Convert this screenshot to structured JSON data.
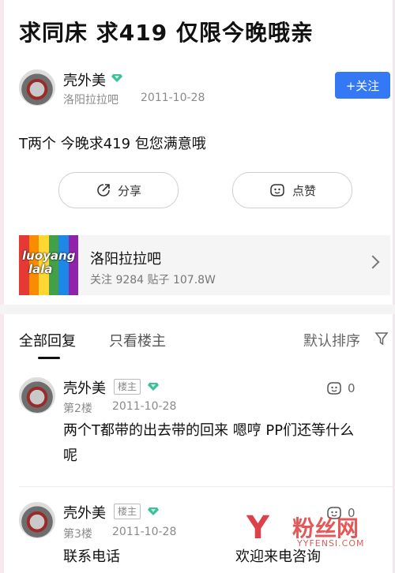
{
  "post": {
    "title": "求同床 求419 仅限今晚哦亲",
    "author": "壳外美",
    "forum_name": "洛阳拉拉吧",
    "date": "2011-10-28",
    "follow_label": "+关注",
    "content": "T两个 今晚求419 包您满意哦",
    "share_label": "分享",
    "like_label": "点赞"
  },
  "forum": {
    "logo_text_line1": "luoyang",
    "logo_text_line2": "lala",
    "logo_stripes": [
      "#e53935",
      "#fb8c00",
      "#fdd835",
      "#43a047",
      "#1e88e5",
      "#8e24aa"
    ],
    "name": "洛阳拉拉吧",
    "stats": "关注 9284  贴子 107.8W"
  },
  "tabs": {
    "all_replies": "全部回复",
    "owner_only": "只看楼主",
    "sort": "默认排序"
  },
  "replies": [
    {
      "author": "壳外美",
      "owner_tag": "楼主",
      "floor": "第2楼",
      "date": "2011-10-28",
      "likes": "0",
      "line1": "两个T都带的出去带的回来 嗯哼 PP们还等什么",
      "line2": "呢"
    },
    {
      "author": "壳外美",
      "owner_tag": "楼主",
      "floor": "第3楼",
      "date": "2011-10-28",
      "likes": "0",
      "text_left": "联系电话",
      "text_right": "欢迎来电咨询"
    }
  ],
  "watermark": {
    "text": "粉丝网",
    "url": "YYFENSI.COM"
  },
  "colors": {
    "accent": "#3478f6",
    "gem": "#3dbf9a",
    "watermark": "#d6202a"
  }
}
